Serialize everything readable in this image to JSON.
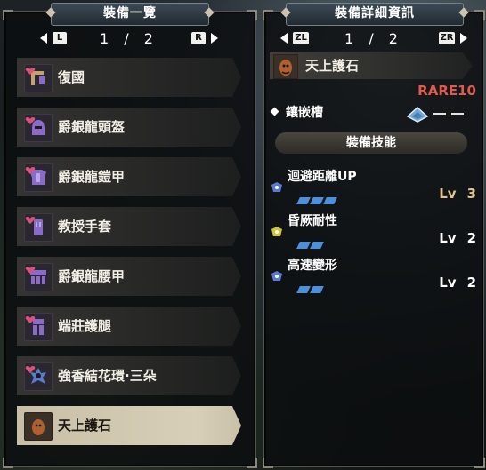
{
  "left_panel": {
    "title": "裝備一覽",
    "pager": {
      "left_button": "L",
      "right_button": "R",
      "page": "1 / 2"
    },
    "items": [
      {
        "name": "復國",
        "icon": "weapon-gunlance-icon",
        "color": "#c7a070"
      },
      {
        "name": "爵銀龍頭盔",
        "icon": "helmet-icon",
        "color": "#8a6cc8"
      },
      {
        "name": "爵銀龍鎧甲",
        "icon": "chest-armor-icon",
        "color": "#8a6cc8"
      },
      {
        "name": "教授手套",
        "icon": "gloves-icon",
        "color": "#8a6cc8"
      },
      {
        "name": "爵銀龍腰甲",
        "icon": "waist-armor-icon",
        "color": "#8a6cc8"
      },
      {
        "name": "端莊護腿",
        "icon": "leg-armor-icon",
        "color": "#8a6cc8"
      },
      {
        "name": "強香結花環·三朵",
        "icon": "charm-icon",
        "color": "#5a7ccf"
      },
      {
        "name": "天上護石",
        "icon": "mantle-icon",
        "color": "#b0602e",
        "selected": true
      }
    ]
  },
  "right_panel": {
    "title": "裝備詳細資訊",
    "pager": {
      "left_button": "ZL",
      "right_button": "ZR",
      "page": "1 / 2"
    },
    "item_name": "天上護石",
    "rarity": "RARE10",
    "slots_label": "鑲嵌槽",
    "section_title": "裝備技能",
    "skills": [
      {
        "name": "迴避距離UP",
        "lv_label": "Lv",
        "level": "3",
        "filled": 3,
        "total": 3,
        "icon_color": "#5a7ccf"
      },
      {
        "name": "昏厥耐性",
        "lv_label": "Lv",
        "level": "2",
        "filled": 2,
        "total": 2,
        "icon_color": "#d4c23c"
      },
      {
        "name": "高速變形",
        "lv_label": "Lv",
        "level": "2",
        "filled": 2,
        "total": 2,
        "icon_color": "#5a7ccf"
      }
    ]
  },
  "colors": {
    "rarity": "#e05a4e",
    "pip": "#4d8fd8",
    "max_level": "#e3c48b",
    "heart": "#d8537a"
  }
}
